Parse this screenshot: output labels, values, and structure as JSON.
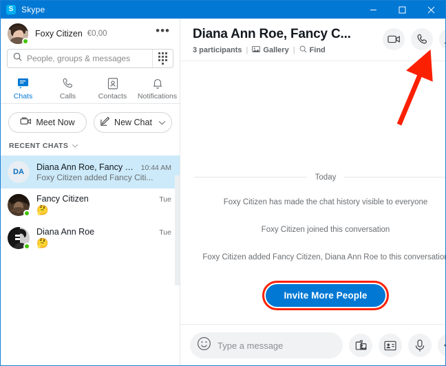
{
  "window": {
    "app_name": "Skype",
    "logo_letter": "S",
    "controls": {
      "minimize": "—",
      "maximize": "☐",
      "close": "✕"
    }
  },
  "sidebar": {
    "profile": {
      "name": "Foxy Citizen",
      "balance": "€0,00",
      "more": "•••",
      "status": "online"
    },
    "search": {
      "placeholder": "People, groups & messages",
      "value": ""
    },
    "tabs": [
      {
        "label": "Chats",
        "icon": "chat-icon",
        "active": true
      },
      {
        "label": "Calls",
        "icon": "phone-icon",
        "active": false
      },
      {
        "label": "Contacts",
        "icon": "contacts-icon",
        "active": false
      },
      {
        "label": "Notifications",
        "icon": "bell-icon",
        "active": false
      }
    ],
    "actions": {
      "meet_now": "Meet Now",
      "new_chat": "New Chat",
      "new_chat_chevron": "∨"
    },
    "recent_header": "RECENT CHATS",
    "recent_chevron": "∨",
    "chats": [
      {
        "name": "Diana Ann Roe, Fancy Citizen",
        "preview": "Foxy Citizen added Fancy Citi...",
        "time": "10:44 AM",
        "initials": "DA",
        "avatar_type": "initials",
        "selected": true
      },
      {
        "name": "Fancy Citizen",
        "preview": "🤔",
        "time": "Tue",
        "initials": "",
        "avatar_type": "photo",
        "selected": false
      },
      {
        "name": "Diana Ann Roe",
        "preview": "🤔",
        "time": "Tue",
        "initials": "",
        "avatar_type": "photo",
        "selected": false
      }
    ]
  },
  "main": {
    "title": "Diana Ann Roe, Fancy C...",
    "participants": "3 participants",
    "separator": "|",
    "gallery": "Gallery",
    "find": "Find",
    "actions": [
      {
        "name": "video-call-button",
        "icon": "video-camera-icon"
      },
      {
        "name": "audio-call-button",
        "icon": "phone-icon"
      },
      {
        "name": "add-people-button",
        "icon": "add-person-icon"
      }
    ],
    "day_label": "Today",
    "system_messages": [
      "Foxy Citizen has made the chat history visible to everyone",
      "Foxy Citizen joined this conversation",
      "Foxy Citizen added Fancy Citizen, Diana Ann Roe to this conversation"
    ],
    "cta_label": "Invite More People",
    "composer": {
      "placeholder": "Type a message",
      "value": "",
      "emoji_icon": "smiley-icon",
      "buttons": [
        {
          "name": "send-image-button",
          "icon": "image-icon"
        },
        {
          "name": "send-contact-button",
          "icon": "contact-card-icon"
        },
        {
          "name": "voice-message-button",
          "icon": "microphone-icon"
        },
        {
          "name": "more-options-button",
          "icon": "ellipsis-icon",
          "badge": true
        }
      ]
    }
  },
  "annotation": {
    "type": "arrow",
    "color": "#fc2003",
    "points_to": "add-people-button"
  },
  "colors": {
    "titlebar": "#0078d4",
    "accent": "#0078d4",
    "selected_chat": "#cceaf9",
    "online": "#41c300",
    "annotation": "#fc2003",
    "badge": "#fb2a1d"
  }
}
